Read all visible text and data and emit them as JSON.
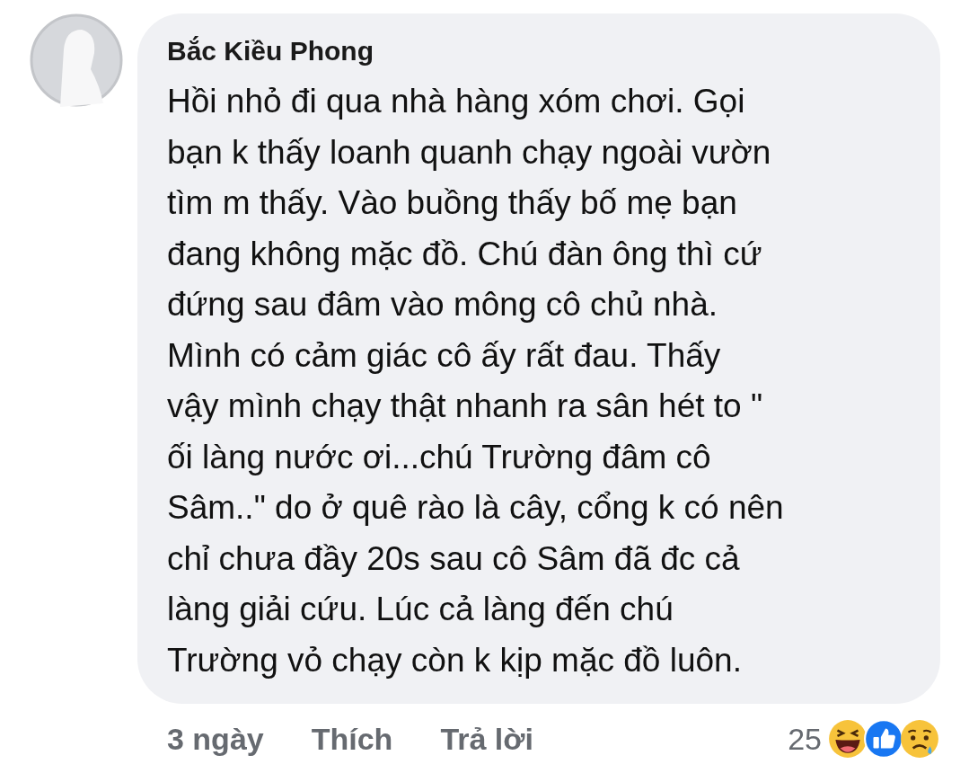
{
  "comment": {
    "author": "Bắc Kiều Phong",
    "lines": [
      "Hồi nhỏ đi qua nhà hàng xóm chơi. Gọi",
      "bạn k thấy loanh quanh chạy ngoài vườn",
      "tìm m thấy. Vào buồng thấy bố mẹ bạn",
      "đang không mặc đồ. Chú đàn ông thì cứ",
      "đứng sau đâm vào mông cô chủ nhà.",
      "Mình có cảm giác cô ấy rất đau. Thấy",
      "vậy mình chạy thật nhanh ra sân hét to \"",
      "ối làng nước ơi...chú Trường đâm cô",
      "Sâm..\" do ở quê rào là cây, cổng k có nên",
      "chỉ chưa đầy 20s sau cô Sâm đã đc cả",
      "làng giải cứu. Lúc cả làng đến chú",
      "Trường vỏ chạy còn k kịp mặc đồ luôn."
    ]
  },
  "actions": {
    "time": "3 ngày",
    "like": "Thích",
    "reply": "Trả lời"
  },
  "reactions": {
    "count": "25"
  }
}
